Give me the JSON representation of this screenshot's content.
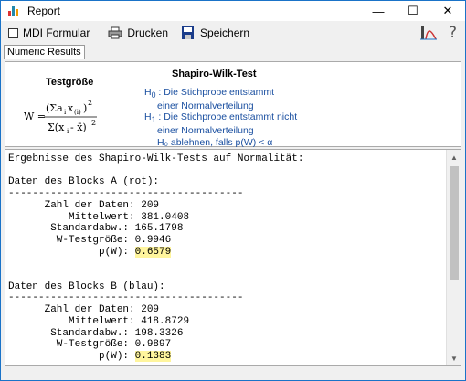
{
  "window": {
    "title": "Report",
    "minimize": "—",
    "maximize": "☐",
    "close": "✕"
  },
  "toolbar": {
    "mdi_label": "MDI Formular",
    "print_label": "Drucken",
    "save_label": "Speichern",
    "help_label": "?"
  },
  "tabs": [
    {
      "label": "Numeric Results"
    }
  ],
  "header": {
    "teststat_label": "Testgröße",
    "test_title": "Shapiro-Wilk-Test",
    "h0_sym": "H",
    "h0_sub": "0",
    "h0_line1": ": Die Stichprobe entstammt",
    "h0_line2": "einer  Normalverteilung",
    "h1_sym": "H",
    "h1_sub": "1",
    "h1_line1": ":  Die Stichprobe entstammt nicht",
    "h1_line2": "einer  Normalverteilung",
    "reject_rule": "H₀ ablehnen, falls  p(W) < α"
  },
  "output": {
    "heading": "Ergebnisse des Shapiro-Wilk-Tests auf Normalität:",
    "separator": "---------------------------------------",
    "blocks": [
      {
        "title": "Daten des Blocks A (rot):",
        "rows": [
          {
            "label": "      Zahl der Daten: ",
            "value": "209"
          },
          {
            "label": "          Mittelwert: ",
            "value": "381.0408"
          },
          {
            "label": "       Standardabw.: ",
            "value": "165.1798"
          },
          {
            "label": "        W-Testgröße: ",
            "value": "0.9946"
          }
        ],
        "p_label": "               p(W): ",
        "p_value": "0.6579"
      },
      {
        "title": "Daten des Blocks B (blau):",
        "rows": [
          {
            "label": "      Zahl der Daten: ",
            "value": "209"
          },
          {
            "label": "          Mittelwert: ",
            "value": "418.8729"
          },
          {
            "label": "       Standardabw.: ",
            "value": "198.3326"
          },
          {
            "label": "        W-Testgröße: ",
            "value": "0.9897"
          }
        ],
        "p_label": "               p(W): ",
        "p_value": "0.1383"
      }
    ]
  },
  "colors": {
    "accent": "#1a73c8",
    "highlight": "#fff59d",
    "hypothesis_text": "#1a4fa0"
  }
}
